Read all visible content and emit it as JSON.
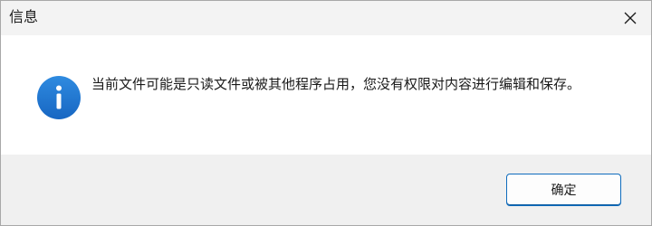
{
  "window": {
    "title": "信息",
    "close_icon": "close-icon"
  },
  "dialog": {
    "icon": "info-icon",
    "message": "当前文件可能是只读文件或被其他程序占用，您没有权限对内容进行编辑和保存。"
  },
  "buttons": {
    "ok_label": "确定"
  },
  "colors": {
    "accent": "#0f6cbd",
    "info_icon": "#1f78d1",
    "titlebar_bg": "#f3f3f3",
    "footer_bg": "#f0f0f0"
  }
}
